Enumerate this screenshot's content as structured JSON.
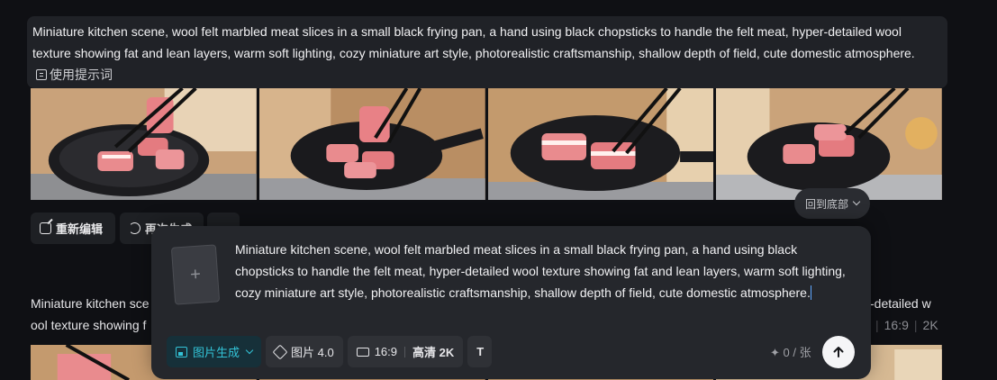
{
  "prompt_banner": {
    "text": "Miniature kitchen scene, wool felt marbled meat slices in a small black frying pan, a hand using black chopsticks to handle the felt meat, hyper-detailed wool texture showing fat and lean layers, warm soft lighting, cozy miniature art style, photorealistic craftsmanship, shallow depth of field, cute domestic atmosphere.",
    "use_prompt_label": "使用提示词",
    "use_prompt_icon": "prompt-icon"
  },
  "actions": {
    "edit_label": "重新编辑",
    "regen_label": "再次生成",
    "more_label": "···"
  },
  "back_to_bottom": "回到底部",
  "second_prompt": {
    "left_fragment_line1": "Miniature kitchen sce",
    "left_fragment_line2": "ool texture showing f",
    "right_fragment": "-detailed w",
    "ratio": "16:9",
    "resolution": "2K"
  },
  "composer": {
    "text": "Miniature kitchen scene, wool felt marbled meat slices in a small black frying pan, a hand using black chopsticks to handle the felt meat, hyper-detailed wool texture showing fat and lean layers, warm soft lighting, cozy miniature art style, photorealistic craftsmanship, shallow depth of field, cute domestic atmosphere.",
    "upload_symbol": "+",
    "mode_label": "图片生成",
    "model_label": "图片 4.0",
    "ratio_label": "16:9",
    "quality_label": "高清 2K",
    "text_tool_label": "T",
    "counter_label": "✦ 0 / 张"
  },
  "colors": {
    "accent": "#33c3d7",
    "background": "#0f1014",
    "panel": "#25272c"
  }
}
